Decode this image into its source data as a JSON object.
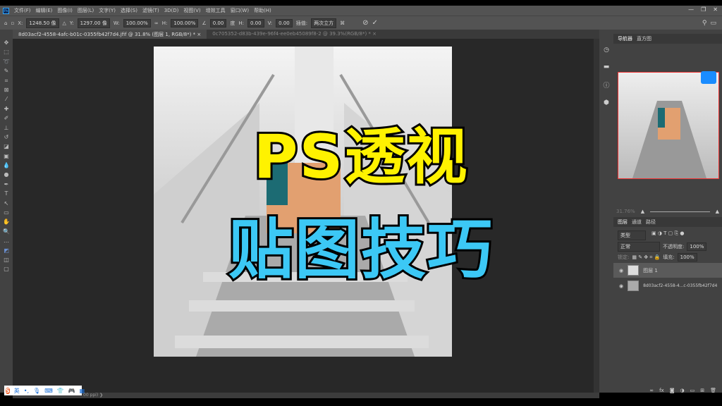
{
  "menu": [
    "文件(F)",
    "编辑(E)",
    "图像(I)",
    "图层(L)",
    "文字(Y)",
    "选择(S)",
    "滤镜(T)",
    "3D(D)",
    "视图(V)",
    "增效工具",
    "窗口(W)",
    "帮助(H)"
  ],
  "options": {
    "x_label": "X:",
    "x": "1248.50 像",
    "y_label": "Y:",
    "y": "1297.00 像",
    "w_label": "W:",
    "w": "100.00%",
    "h_label": "H:",
    "h": "100.00%",
    "angle": "0.00",
    "angle_unit": "度",
    "hskew_label": "H:",
    "hskew": "0.00",
    "v_label": "V:",
    "v": "0.00",
    "interp_label": "插值:",
    "interp": "两次立方"
  },
  "tabs": [
    "8d03acf2-4558-4afc-b01c-0355fb42f7d4.jfif @ 31.8% (图层 1, RGB/8*) *",
    "0c705352-d83b-439e-96f4-ee0eb45089f8-2 @ 39.3%(RGB/8*) *"
  ],
  "overlay": {
    "line1": "PS透视",
    "line2": "贴图技巧"
  },
  "panel": {
    "nav_tabs": [
      "导航器",
      "直方图"
    ],
    "zoom": "31.76%",
    "layer_tabs": [
      "图层",
      "通道",
      "路径"
    ],
    "filter": "类型",
    "blend": "正常",
    "opacity_label": "不透明度:",
    "opacity": "100%",
    "lock_label": "锁定:",
    "fill_label": "填充:",
    "fill": "100%",
    "layers": [
      "图层 1",
      "8d03acf2-4558-4...c-0355fb42f7d4"
    ]
  },
  "status": "00 ppi)",
  "ime": {
    "lang": "英"
  }
}
